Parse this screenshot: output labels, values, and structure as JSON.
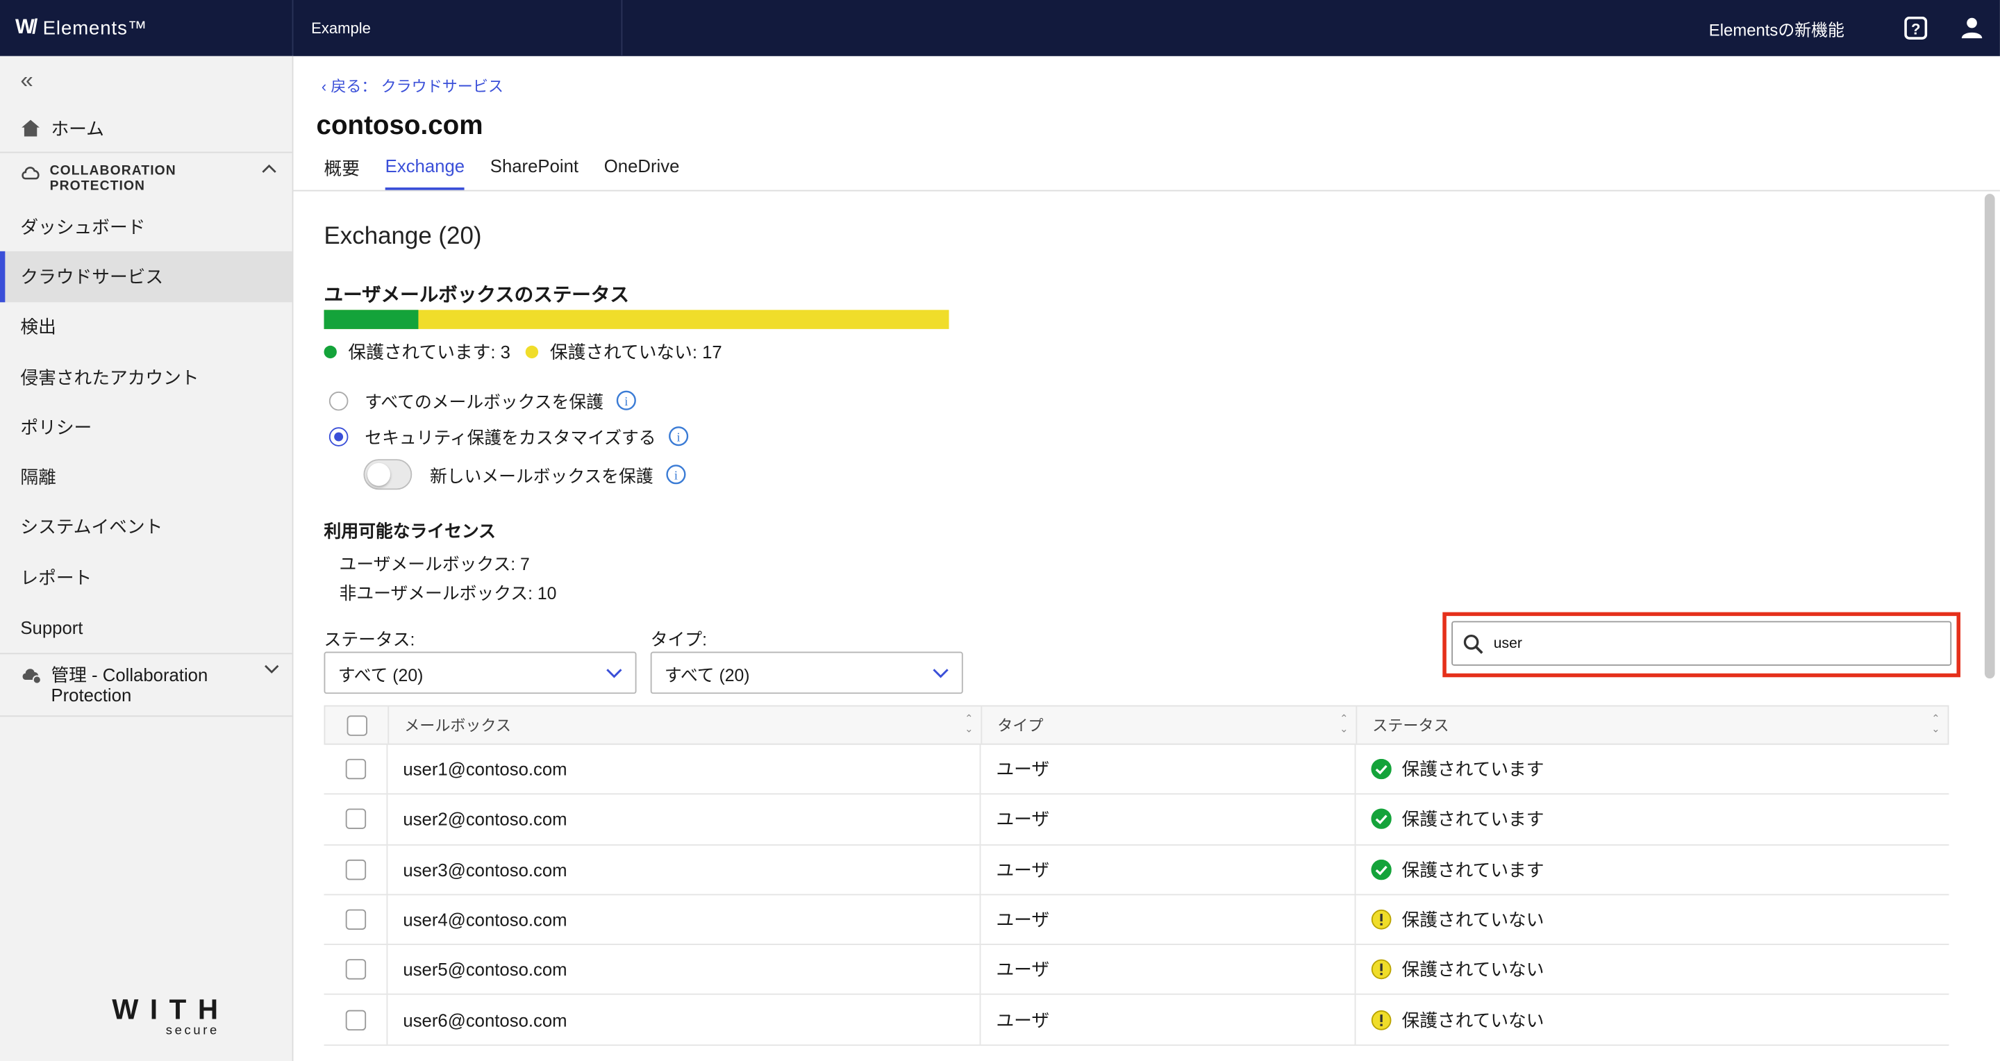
{
  "topbar": {
    "brand": "Elements™",
    "org": "Example",
    "whats_new": "Elementsの新機能"
  },
  "sidebar": {
    "home": "ホーム",
    "section": "COLLABORATION PROTECTION",
    "items": [
      "ダッシュボード",
      "クラウドサービス",
      "検出",
      "侵害されたアカウント",
      "ポリシー",
      "隔離",
      "システムイベント",
      "レポート",
      "Support"
    ],
    "active_index": 1,
    "management": "管理 - Collaboration Protection",
    "footer_logo_top": "WITH",
    "footer_logo_bottom": "secure"
  },
  "header": {
    "back": "戻る： クラウドサービス",
    "title": "contoso.com",
    "tabs": [
      "概要",
      "Exchange",
      "SharePoint",
      "OneDrive"
    ],
    "active_tab": 1
  },
  "exchange": {
    "heading": "Exchange (20)",
    "status_title": "ユーザメールボックスのステータス",
    "protected_fraction": 0.15,
    "protected_label": "保護されています: 3",
    "unprotected_label": "保護されていない: 17",
    "radio_all": "すべてのメールボックスを保護",
    "radio_custom": "セキュリティ保護をカスタマイズする",
    "toggle_new": "新しいメールボックスを保護",
    "licenses_title": "利用可能なライセンス",
    "license_user": "ユーザメールボックス: 7",
    "license_nonuser": "非ユーザメールボックス: 10"
  },
  "filters": {
    "status_label": "ステータス:",
    "status_value": "すべて (20)",
    "type_label": "タイプ:",
    "type_value": "すべて (20)"
  },
  "search": {
    "value": "user"
  },
  "table": {
    "headers": [
      "メールボックス",
      "タイプ",
      "ステータス"
    ],
    "rows": [
      {
        "mailbox": "user1@contoso.com",
        "type": "ユーザ",
        "status": "保護されています",
        "ok": true
      },
      {
        "mailbox": "user2@contoso.com",
        "type": "ユーザ",
        "status": "保護されています",
        "ok": true
      },
      {
        "mailbox": "user3@contoso.com",
        "type": "ユーザ",
        "status": "保護されています",
        "ok": true
      },
      {
        "mailbox": "user4@contoso.com",
        "type": "ユーザ",
        "status": "保護されていない",
        "ok": false
      },
      {
        "mailbox": "user5@contoso.com",
        "type": "ユーザ",
        "status": "保護されていない",
        "ok": false
      },
      {
        "mailbox": "user6@contoso.com",
        "type": "ユーザ",
        "status": "保護されていない",
        "ok": false
      }
    ]
  },
  "colors": {
    "navy": "#121a3d",
    "accent": "#3a4fd8",
    "green": "#14a33a",
    "yellow": "#f0dd2a",
    "highlight": "#e5301b"
  }
}
